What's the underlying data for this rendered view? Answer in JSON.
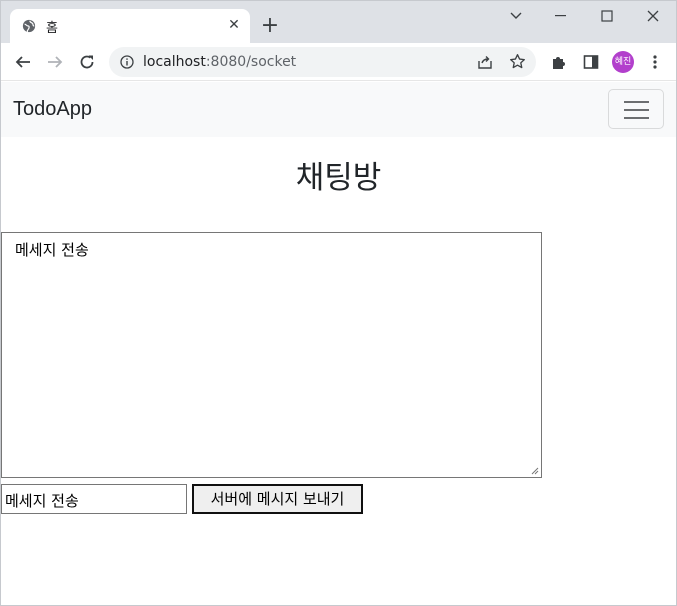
{
  "browser": {
    "tab": {
      "title": "홈",
      "favicon": "globe-icon",
      "close_glyph": "✕"
    },
    "new_tab_glyph": "+",
    "address": {
      "host": "localhost",
      "rest": ":8080/socket"
    },
    "profile_initials": "혜진",
    "colors": {
      "tabstrip": "#dee1e6",
      "omnibox": "#f1f3f4",
      "avatar": "#b23fcc"
    }
  },
  "navbar": {
    "brand": "TodoApp"
  },
  "main": {
    "heading": "채팅방",
    "chat_log": "메세지 전송",
    "message_input": {
      "value": "메세지 전송"
    },
    "send_button": "서버에 메시지 보내기"
  }
}
